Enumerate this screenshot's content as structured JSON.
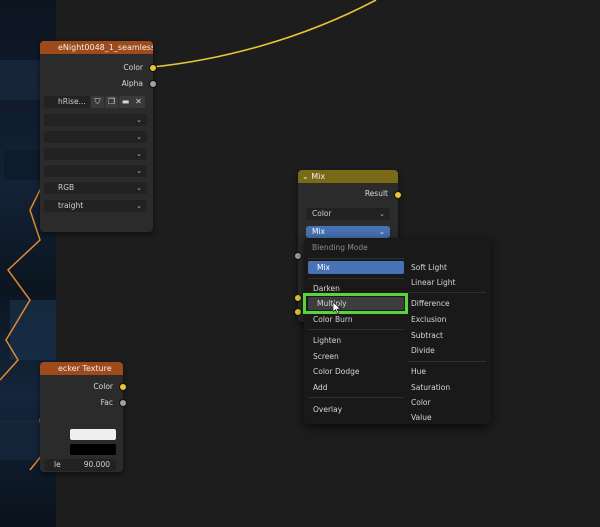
{
  "image_texture_node": {
    "title": "eNight0048_1_seamless...",
    "output_color": "Color",
    "output_alpha": "Alpha",
    "image_name": "hRise...",
    "dropdown_row_5": "RGB",
    "dropdown_row_6": "traight"
  },
  "checker_node": {
    "title": "ecker Texture",
    "output_color": "Color",
    "output_fac": "Fac",
    "scale_label": "le",
    "scale_value": "90.000"
  },
  "mix_node": {
    "title": "Mix",
    "output_result": "Result",
    "data_type": "Color",
    "blend_mode": "Mix"
  },
  "blending_menu": {
    "title": "Blending Mode",
    "left_items": [
      "Mix",
      "Darken",
      "Multiply",
      "Color Burn",
      "Lighten",
      "Screen",
      "Color Dodge",
      "Add",
      "Overlay"
    ],
    "right_items": [
      "Soft Light",
      "Linear Light",
      "Difference",
      "Exclusion",
      "Subtract",
      "Divide",
      "Hue",
      "Saturation",
      "Color",
      "Value"
    ],
    "selected": "Mix",
    "hovered": "Multiply"
  },
  "colors": {
    "wire_yellow": "#e5c637",
    "selected_blue": "#4772b3",
    "highlight_green": "#57d63c"
  }
}
